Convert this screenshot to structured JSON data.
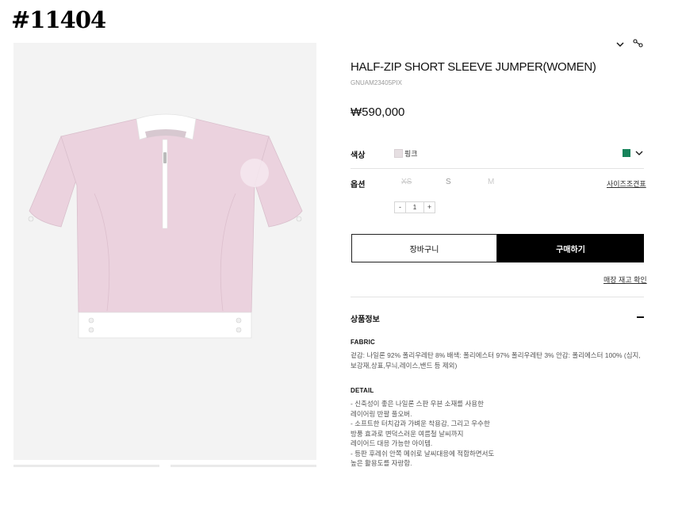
{
  "page_tag": "#11404",
  "product": {
    "title": "HALF-ZIP SHORT SLEEVE JUMPER(WOMEN)",
    "code": "GNUAM23405PIX",
    "price": "₩590,000"
  },
  "colors": {
    "garment_pink": "#ebd2de",
    "garment_white": "#ffffff",
    "green_swatch": "#17835a",
    "buy_button": "#000000"
  },
  "color_row": {
    "label": "색상",
    "selected_name": "핑크"
  },
  "option_row": {
    "label": "옵션",
    "sizes": [
      "XS",
      "S",
      "M"
    ],
    "size_chart_link": "사이즈조견표"
  },
  "quantity": {
    "minus": "-",
    "value": "1",
    "plus": "+"
  },
  "actions": {
    "cart": "장바구니",
    "buy": "구매하기",
    "store_stock": "매장 재고 확인"
  },
  "info": {
    "heading": "상품정보",
    "fabric_heading": "FABRIC",
    "fabric_text": "겉감: 나일론 92% 폴리우레탄 8% 배색: 폴리에스터 97% 폴리우레탄 3% 안감: 폴리에스터 100% (심지,보강재,상표,무늬,레이스,밴드 등 제외)",
    "detail_heading": "DETAIL",
    "detail_lines": [
      "- 신축성이 좋은 나일론 스판 우븐 소재를 사용한",
      "  레이어링 반팔 풀오버.",
      "- 소프트한 터치감과 가벼운 착용감, 그리고 우수한",
      "  방풍 효과로 변덕스러운 여름철 날씨까지",
      "  레이어드 대응 가능한 아이템.",
      "- 등판 후레쉬 안쪽 메쉬로 날씨대응에 적합하면서도",
      "  높은 활용도를 자랑함."
    ]
  }
}
